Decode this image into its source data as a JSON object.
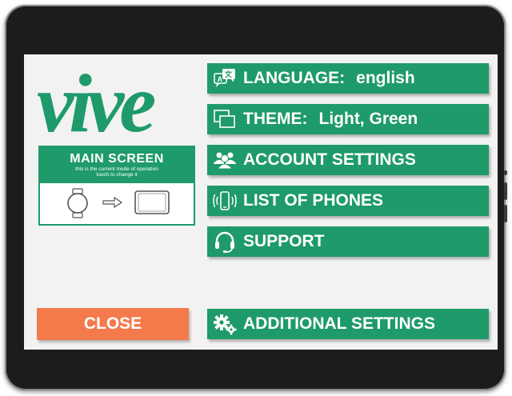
{
  "app": {
    "logo_text": "vive"
  },
  "mode_card": {
    "title": "MAIN SCREEN",
    "subtitle_line1": "this is the current mode of operation",
    "subtitle_line2": "touch to change it"
  },
  "menu": {
    "language": {
      "label": "LANGUAGE:",
      "value": "english"
    },
    "theme": {
      "label": "THEME:",
      "value": "Light, Green"
    },
    "account_settings": {
      "label": "ACCOUNT SETTINGS"
    },
    "list_of_phones": {
      "label": "LIST OF PHONES"
    },
    "support": {
      "label": "SUPPORT"
    },
    "additional_settings": {
      "label": "ADDITIONAL SETTINGS"
    }
  },
  "close_button": {
    "label": "CLOSE"
  },
  "colors": {
    "primary_green": "#1e9a6b",
    "close_orange": "#f47a4c",
    "screen_bg": "#f2f2f2"
  },
  "icons": [
    "translate-icon",
    "windows-icon",
    "users-icon",
    "phone-ringing-icon",
    "headset-icon",
    "gears-icon",
    "watch-icon",
    "arrow-right-icon",
    "tablet-icon"
  ]
}
